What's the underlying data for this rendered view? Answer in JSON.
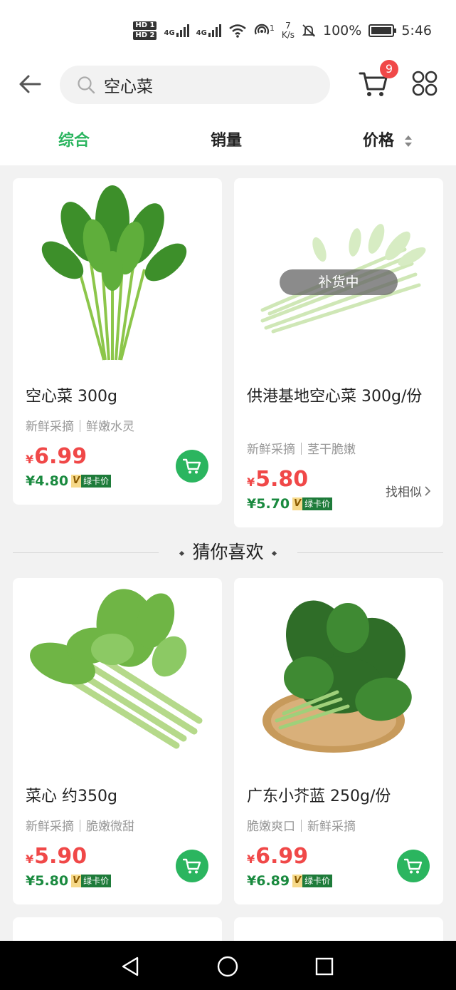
{
  "status_bar": {
    "hd1": "HD 1",
    "hd2": "HD 2",
    "net1": "4G",
    "net2": "4G",
    "wifi_num": "1",
    "net_speed_value": "7",
    "net_speed_unit": "K/s",
    "battery": "100%",
    "time": "5:46",
    "icons": [
      "signal-icon",
      "wifi-icon",
      "hotspot-icon",
      "mute-bell-icon",
      "battery-icon"
    ]
  },
  "header": {
    "search_value": "空心菜",
    "cart_badge": "9",
    "icons": [
      "back-arrow-icon",
      "search-icon",
      "cart-icon",
      "grid-menu-icon"
    ]
  },
  "sort_tabs": [
    {
      "label": "综合",
      "active": true
    },
    {
      "label": "销量",
      "active": false
    },
    {
      "label": "价格",
      "active": false
    }
  ],
  "products": [
    {
      "title": "空心菜 300g",
      "subtitle": "新鲜采摘｜鲜嫩水灵",
      "price_symbol": "¥",
      "price": "6.99",
      "vip_price": "¥4.80",
      "vip_v": "V",
      "vip_label": "绿卡价"
    },
    {
      "title": "供港基地空心菜 300g/份",
      "subtitle": "新鲜采摘｜茎干脆嫩",
      "price_symbol": "¥",
      "price": "5.80",
      "vip_price": "¥5.70",
      "vip_v": "V",
      "vip_label": "绿卡价",
      "restock_label": "补货中",
      "similar_label": "找相似"
    }
  ],
  "recommend_title": "猜你喜欢",
  "recommendations": [
    {
      "title": "菜心 约350g",
      "subtitle": "新鲜采摘｜脆嫩微甜",
      "price_symbol": "¥",
      "price": "5.90",
      "vip_price": "¥5.80",
      "vip_v": "V",
      "vip_label": "绿卡价"
    },
    {
      "title": "广东小芥蓝 250g/份",
      "subtitle": "脆嫩爽口｜新鲜采摘",
      "price_symbol": "¥",
      "price": "6.99",
      "vip_price": "¥6.89",
      "vip_v": "V",
      "vip_label": "绿卡价"
    }
  ],
  "colors": {
    "accent": "#2bb55f",
    "price_red": "#f04848",
    "vip_green": "#1a8a3f"
  }
}
